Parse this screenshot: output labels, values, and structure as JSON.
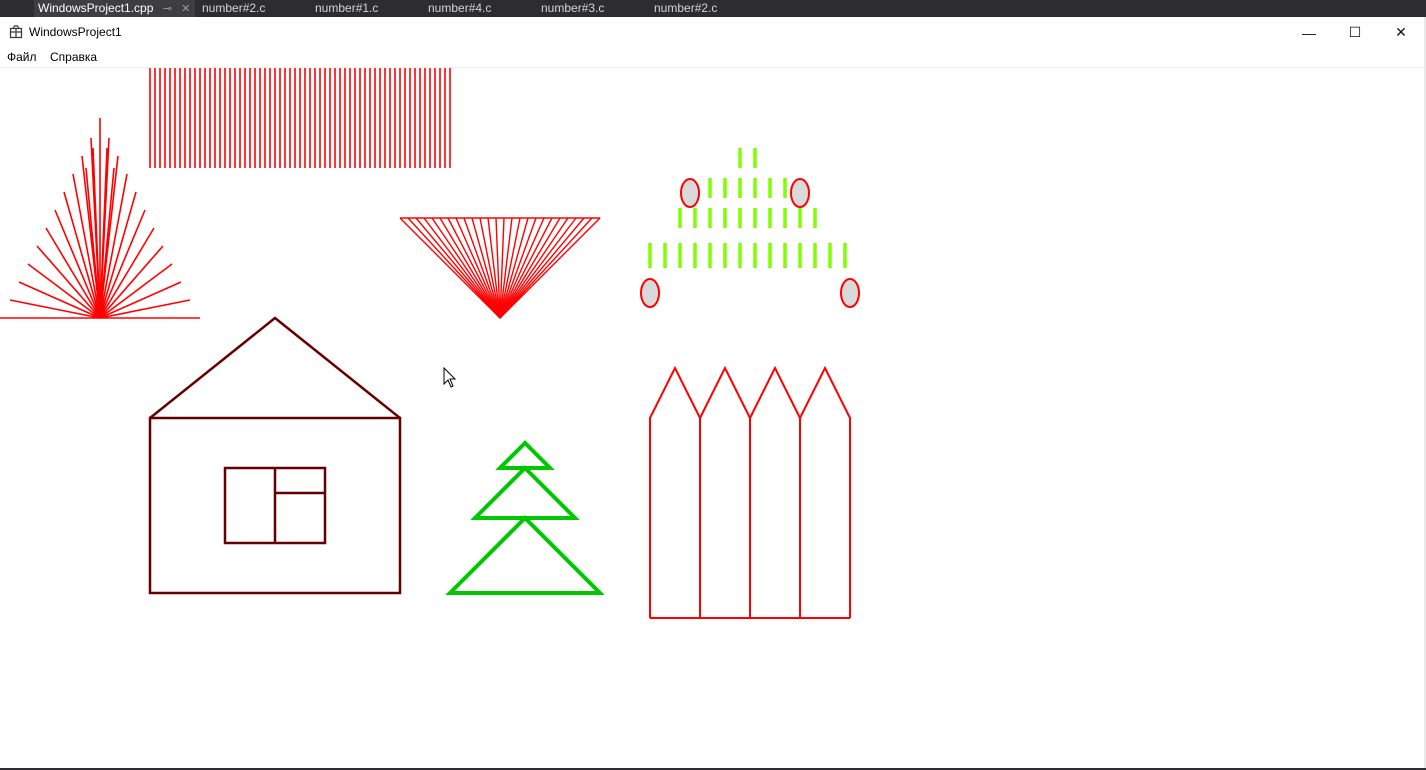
{
  "tabs": [
    {
      "label": "WindowsProject1.cpp",
      "active": true
    },
    {
      "label": "number#2.c"
    },
    {
      "label": "number#1.c"
    },
    {
      "label": "number#4.c"
    },
    {
      "label": "number#3.c"
    },
    {
      "label": "number#2.c"
    }
  ],
  "window": {
    "title": "WindowsProject1",
    "minimize_glyph": "—",
    "maximize_glyph": "☐",
    "close_glyph": "✕"
  },
  "menu": [
    {
      "label": "Файл"
    },
    {
      "label": "Справка"
    }
  ],
  "colors": {
    "red": "#ff0000",
    "house": "#660000",
    "tree": "#00c800",
    "lime": "#80ff00",
    "ellipse_fill": "#d9d9d9"
  },
  "icons": {
    "app": "app-window-icon",
    "pin": "pin-icon",
    "tab_close": "close-icon",
    "cursor": "mouse-cursor-icon"
  }
}
